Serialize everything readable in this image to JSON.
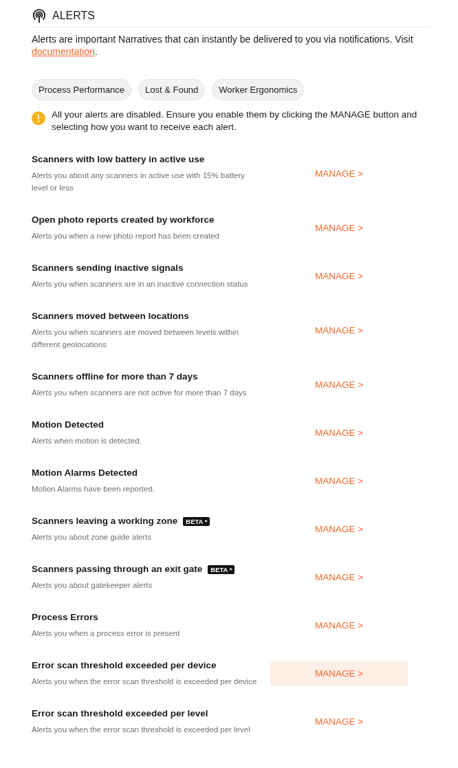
{
  "header": {
    "title": "ALERTS"
  },
  "intro": {
    "text": "Alerts are important Narratives that can instantly be delivered to you via notifications. Visit ",
    "link": "documentation",
    "end": "."
  },
  "categories": [
    {
      "label": "Process Performance"
    },
    {
      "label": "Lost & Found"
    },
    {
      "label": "Worker Ergonomics"
    }
  ],
  "warning": {
    "text": "All your alerts are disabled. Ensure you enable them by clicking the MANAGE button and selecting how you want to receive each alert."
  },
  "alerts": [
    {
      "title": "Scanners with low battery in active use",
      "description": [
        "Alerts you about any scanners in active use with 15% battery",
        "level or less"
      ],
      "action": "MANAGE >",
      "hovered": false
    },
    {
      "title": "Open photo reports created by workforce",
      "description": [
        "Alerts you when a new photo report has been created"
      ],
      "action": "MANAGE >",
      "hovered": false
    },
    {
      "title": "Scanners sending inactive signals",
      "description": [
        "Alerts you when scanners are in an inactive connection status"
      ],
      "action": "MANAGE >",
      "hovered": false
    },
    {
      "title": "Scanners moved between locations",
      "description": [
        "Alerts you when scanners are moved between levels within",
        "different geolocations"
      ],
      "action": "MANAGE >",
      "hovered": false
    },
    {
      "title": "Scanners offline for more than 7 days",
      "description": [
        "Alerts you when scanners are not active for more than 7 days"
      ],
      "action": "MANAGE >",
      "hovered": false
    },
    {
      "title": "Motion Detected",
      "description": [
        "Alerts when motion is detected."
      ],
      "action": "MANAGE >",
      "hovered": false
    },
    {
      "title": "Motion Alarms Detected",
      "description": [
        "Motion Alarms have been reported."
      ],
      "action": "MANAGE >",
      "hovered": false
    },
    {
      "title": "Scanners leaving a working zone",
      "badge": "BETA *",
      "description": [
        "Alerts you about zone guide alerts"
      ],
      "action": "MANAGE >",
      "hovered": false
    },
    {
      "title": "Scanners passing through an exit gate",
      "badge": "BETA *",
      "description": [
        "Alerts you about gatekeeper alerts"
      ],
      "action": "MANAGE >",
      "hovered": false
    },
    {
      "title": "Process Errors",
      "description": [
        "Alerts you when a process error is present"
      ],
      "action": "MANAGE >",
      "hovered": false
    },
    {
      "title": "Error scan threshold exceeded per device",
      "description": [
        "Alerts you when the error scan threshold is exceeded per device"
      ],
      "action": "MANAGE >",
      "hovered": true
    },
    {
      "title": "Error scan threshold exceeded per level",
      "description": [
        "Alerts you when the error scan threshold is exceeded per level"
      ],
      "action": "MANAGE >",
      "hovered": false
    }
  ]
}
